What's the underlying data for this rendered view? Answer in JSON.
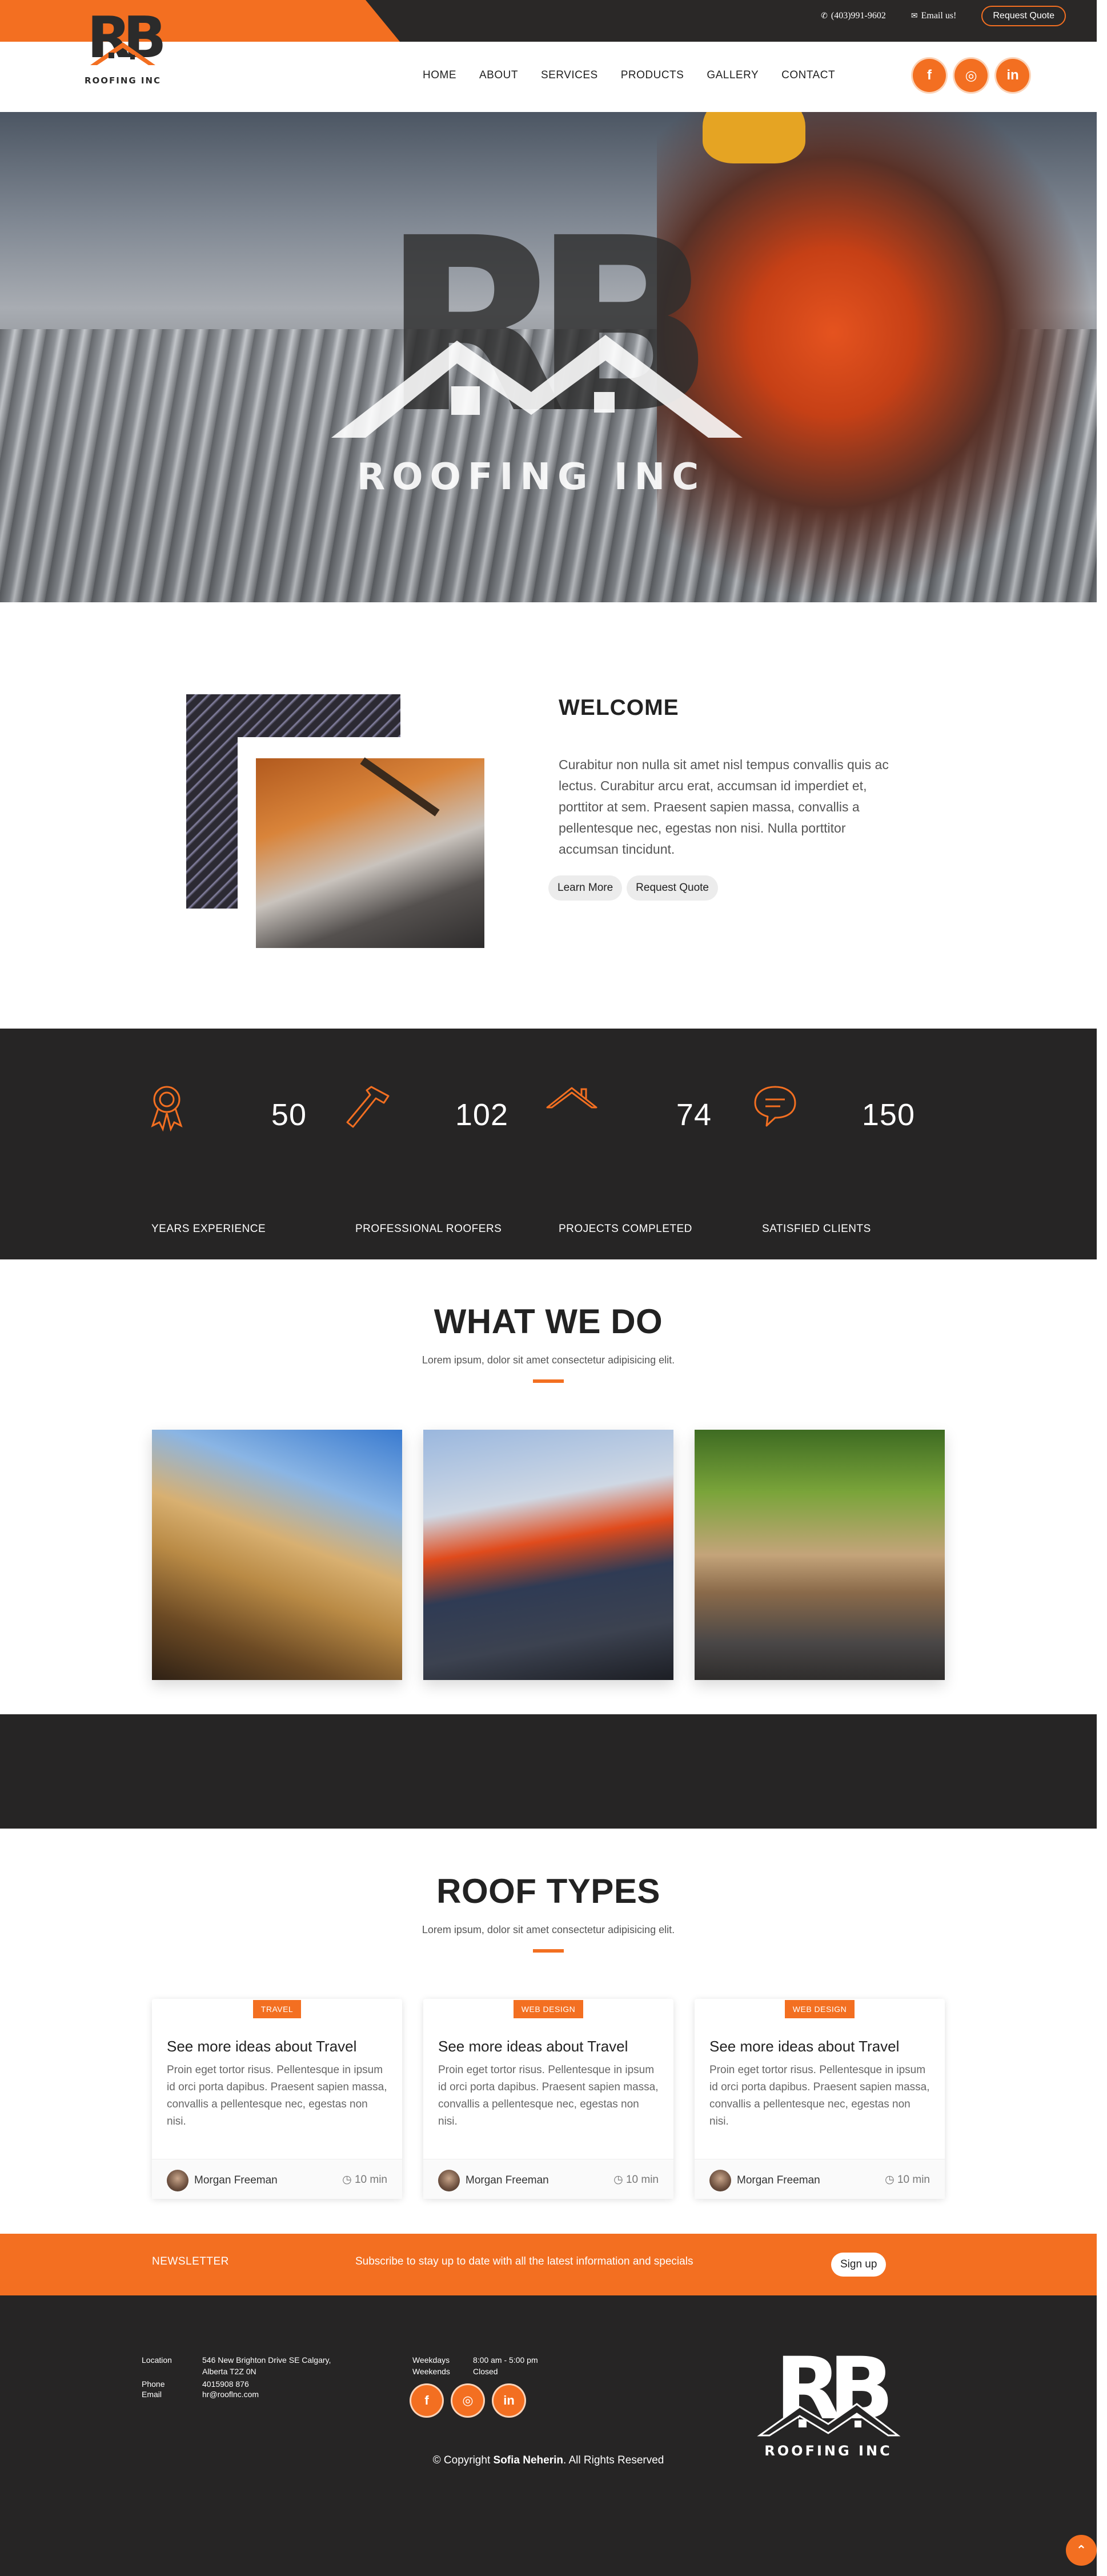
{
  "topbar": {
    "phone": "(403)991-9602",
    "email": "Email us!",
    "quote_button": "Request Quote"
  },
  "brand": {
    "logo_letters": "RB",
    "logo_text": "ROOFING INC",
    "accent_color": "#f36f21",
    "dark_color": "#262525"
  },
  "nav": {
    "items": [
      {
        "label": "HOME"
      },
      {
        "label": "ABOUT"
      },
      {
        "label": "SERVICES"
      },
      {
        "label": "PRODUCTS"
      },
      {
        "label": "GALLERY"
      },
      {
        "label": "CONTACT"
      }
    ],
    "socials": [
      {
        "icon": "facebook-icon",
        "glyph": "f"
      },
      {
        "icon": "instagram-icon",
        "glyph": "◎"
      },
      {
        "icon": "linkedin-icon",
        "glyph": "in"
      }
    ]
  },
  "hero": {
    "logo_text": "ROOFING INC"
  },
  "welcome": {
    "title": "WELCOME",
    "text": "Curabitur non nulla sit amet nisl tempus convallis quis ac lectus. Curabitur arcu erat, accumsan id imperdiet et, porttitor at sem. Praesent sapien massa, convallis a pellentesque nec, egestas non nisi. Nulla porttitor accumsan tincidunt.",
    "learn_more": "Learn More",
    "request_quote": "Request Quote"
  },
  "stats": [
    {
      "icon": "award-icon",
      "value": "50",
      "label": "YEARS EXPERIENCE"
    },
    {
      "icon": "hammer-icon",
      "value": "102",
      "label": "PROFESSIONAL ROOFERS"
    },
    {
      "icon": "house-roof-icon",
      "value": "74",
      "label": "PROJECTS COMPLETED"
    },
    {
      "icon": "chat-bubble-icon",
      "value": "150",
      "label": "SATISFIED CLIENTS"
    }
  ],
  "what_we_do": {
    "title": "WHAT WE DO",
    "subtitle": "Lorem ipsum, dolor sit amet consectetur adipisicing elit."
  },
  "roof_types": {
    "title": "ROOF TYPES",
    "subtitle": "Lorem ipsum, dolor sit amet consectetur adipisicing elit.",
    "cards": [
      {
        "badge": "TRAVEL",
        "title": "See more ideas about Travel",
        "text": "Proin eget tortor risus. Pellentesque in ipsum id orci porta dapibus. Praesent sapien massa, convallis a pellentesque nec, egestas non nisi.",
        "author": "Morgan Freeman",
        "time": "10 min"
      },
      {
        "badge": "WEB DESIGN",
        "title": "See more ideas about Travel",
        "text": "Proin eget tortor risus. Pellentesque in ipsum id orci porta dapibus. Praesent sapien massa, convallis a pellentesque nec, egestas non nisi.",
        "author": "Morgan Freeman",
        "time": "10 min"
      },
      {
        "badge": "WEB DESIGN",
        "title": "See more ideas about Travel",
        "text": "Proin eget tortor risus. Pellentesque in ipsum id orci porta dapibus. Praesent sapien massa, convallis a pellentesque nec, egestas non nisi.",
        "author": "Morgan Freeman",
        "time": "10 min"
      }
    ]
  },
  "newsletter": {
    "title": "NEWSLETTER",
    "text": "Subscribe to stay up to date with all the latest information and specials",
    "button": "Sign up"
  },
  "footer": {
    "location_label": "Location",
    "location_line1": "546 New Brighton Drive SE Calgary,",
    "location_line2": "Alberta T2Z 0N",
    "phone_label": "Phone",
    "phone": "4015908 876",
    "email_label": "Email",
    "email": "hr@rooflnc.com",
    "weekdays_label": "Weekdays",
    "weekdays_hours": "8:00 am - 5:00 pm",
    "weekends_label": "Weekends",
    "weekends_hours": "Closed",
    "copyright_prefix": "© Copyright",
    "copyright_name": "Sofia Neherin",
    "copyright_suffix": ". All Rights Reserved",
    "logo_text": "ROOFING INC"
  }
}
